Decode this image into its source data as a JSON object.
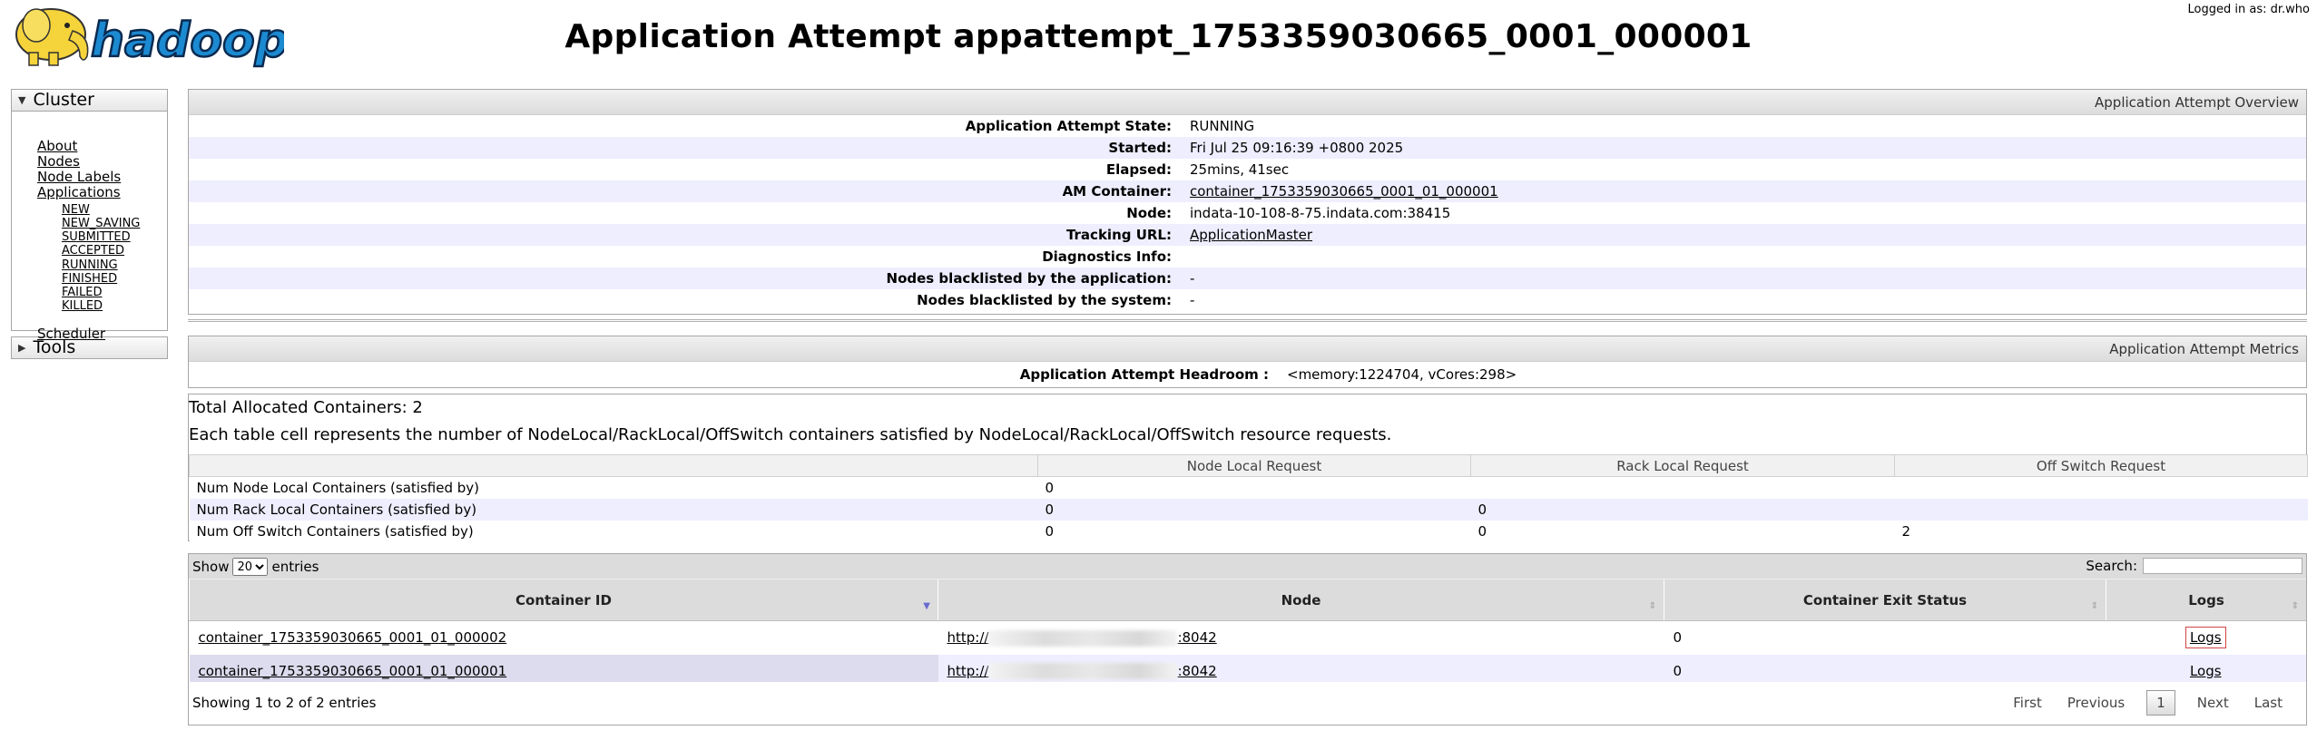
{
  "header": {
    "logo_text": "hadoop",
    "title": "Application Attempt appattempt_1753359030665_0001_000001",
    "logged_in": "Logged in as: dr.who"
  },
  "nav": {
    "cluster_label": "Cluster",
    "cluster_items": [
      "About",
      "Nodes",
      "Node Labels",
      "Applications"
    ],
    "app_states": [
      "NEW",
      "NEW_SAVING",
      "SUBMITTED",
      "ACCEPTED",
      "RUNNING",
      "FINISHED",
      "FAILED",
      "KILLED"
    ],
    "scheduler_label": "Scheduler",
    "tools_label": "Tools"
  },
  "overview": {
    "caption": "Application Attempt Overview",
    "rows": [
      {
        "key": "Application Attempt State:",
        "value": "RUNNING"
      },
      {
        "key": "Started:",
        "value": "Fri Jul 25 09:16:39 +0800 2025"
      },
      {
        "key": "Elapsed:",
        "value": "25mins, 41sec"
      },
      {
        "key": "AM Container:",
        "value": "container_1753359030665_0001_01_000001"
      },
      {
        "key": "Node:",
        "value": "indata-10-108-8-75.indata.com:38415"
      },
      {
        "key": "Tracking URL:",
        "value": "ApplicationMaster"
      },
      {
        "key": "Diagnostics Info:",
        "value": ""
      },
      {
        "key": "Nodes blacklisted by the application:",
        "value": "-"
      },
      {
        "key": "Nodes blacklisted by the system:",
        "value": "-"
      }
    ]
  },
  "metrics": {
    "caption": "Application Attempt Metrics",
    "headroom_key": "Application Attempt Headroom :",
    "headroom_value": "<memory:1224704, vCores:298>"
  },
  "allocation": {
    "total": "Total Allocated Containers: 2",
    "description": "Each table cell represents the number of NodeLocal/RackLocal/OffSwitch containers satisfied by NodeLocal/RackLocal/OffSwitch resource requests.",
    "headers": [
      "",
      "Node Local Request",
      "Rack Local Request",
      "Off Switch Request"
    ],
    "rows": [
      {
        "label": "Num Node Local Containers (satisfied by)",
        "node": "0",
        "rack": "",
        "off": ""
      },
      {
        "label": "Num Rack Local Containers (satisfied by)",
        "node": "0",
        "rack": "0",
        "off": ""
      },
      {
        "label": "Num Off Switch Containers (satisfied by)",
        "node": "0",
        "rack": "0",
        "off": "2"
      }
    ]
  },
  "containers": {
    "show_label": "Show",
    "length_value": "20",
    "entries_label": "entries",
    "search_label": "Search:",
    "search_value": "",
    "columns": [
      "Container ID",
      "Node",
      "Container Exit Status",
      "Logs"
    ],
    "rows": [
      {
        "id": "container_1753359030665_0001_01_000002",
        "node_prefix": "http://",
        "node_suffix": ":8042",
        "exit": "0",
        "logs": "Logs"
      },
      {
        "id": "container_1753359030665_0001_01_000001",
        "node_prefix": "http://",
        "node_suffix": ":8042",
        "exit": "0",
        "logs": "Logs"
      }
    ],
    "info": "Showing 1 to 2 of 2 entries",
    "paging": {
      "first": "First",
      "previous": "Previous",
      "current": "1",
      "next": "Next",
      "last": "Last"
    }
  },
  "colors": {
    "row_odd": "#eeeeff",
    "header_gray": "#dcdcdc",
    "logo_yellow": "#f5d33a",
    "logo_blue": "#1c8ad1"
  }
}
